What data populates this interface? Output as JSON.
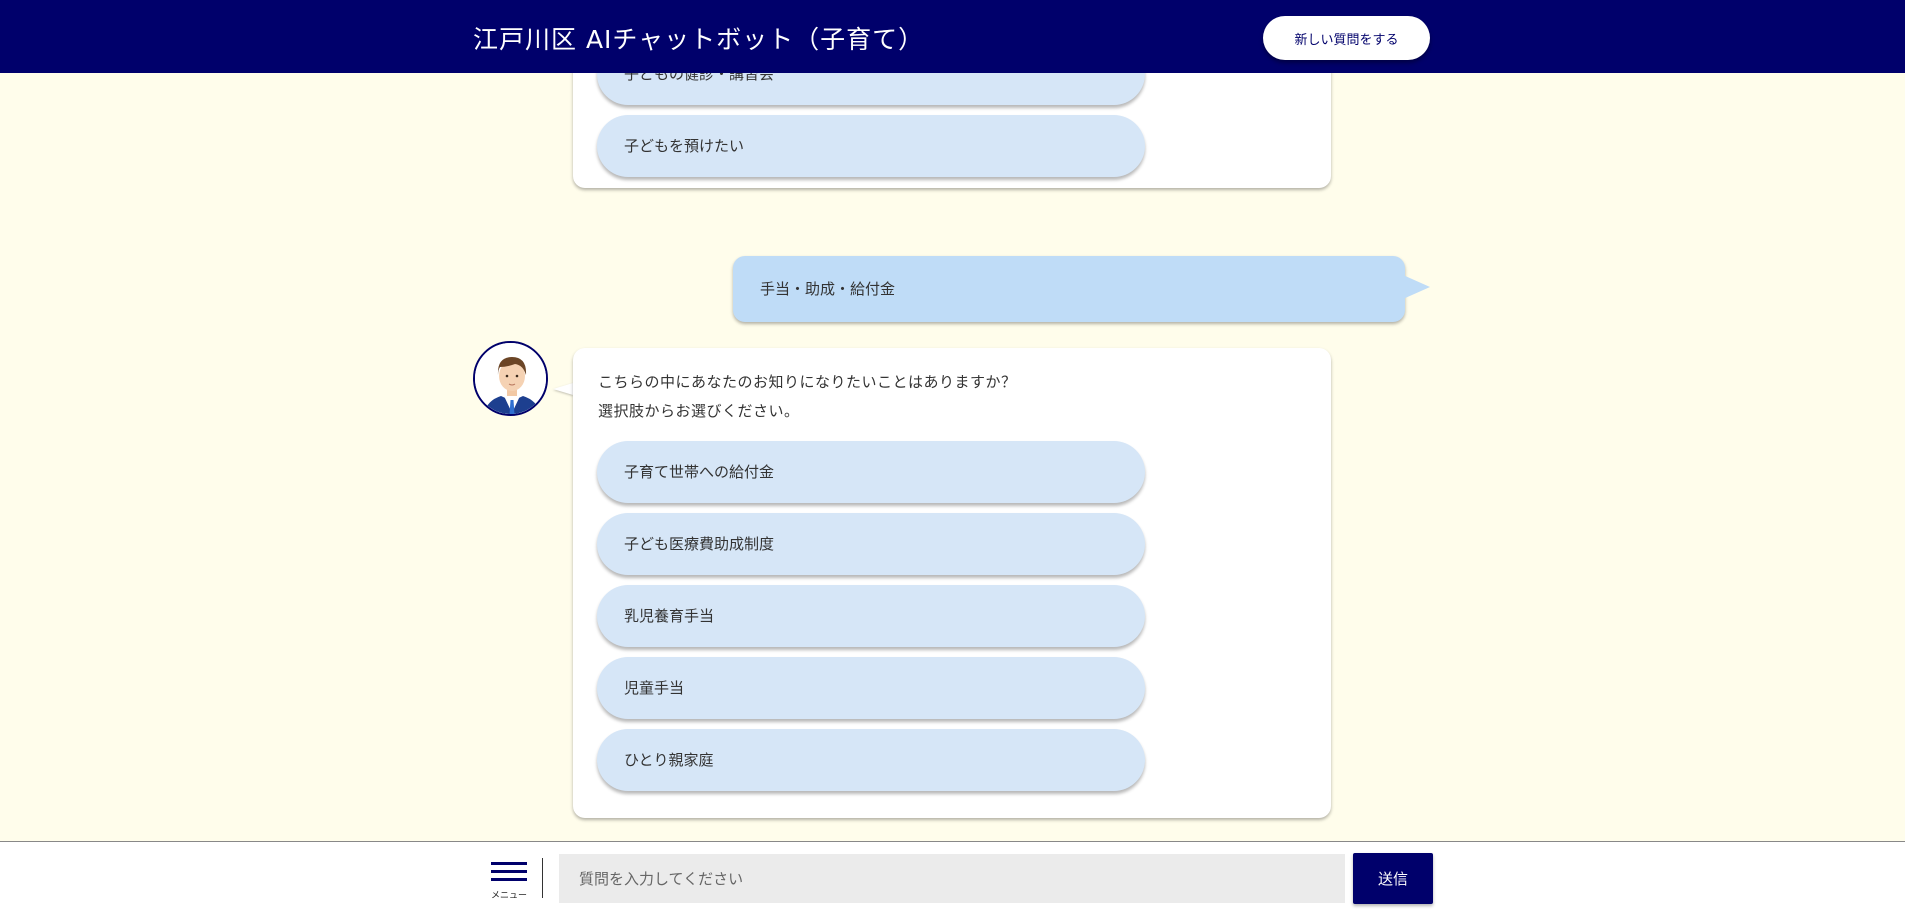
{
  "header": {
    "title": "江戸川区 AIチャットボット（子育て）",
    "new_question_label": "新しい質問をする"
  },
  "previous_bot_message": {
    "choices": [
      {
        "label": "子どもの健診・講習会"
      },
      {
        "label": "子どもを預けたい"
      }
    ]
  },
  "user_message": {
    "text": "手当・助成・給付金"
  },
  "bot_message": {
    "lines": [
      "こちらの中にあなたのお知りになりたいことはありますか？",
      "選択肢からお選びください。"
    ],
    "choices": [
      {
        "label": "子育て世帯への給付金"
      },
      {
        "label": "子ども医療費助成制度"
      },
      {
        "label": "乳児養育手当"
      },
      {
        "label": "児童手当"
      },
      {
        "label": "ひとり親家庭"
      }
    ]
  },
  "footer": {
    "menu_label": "メニュー",
    "input_placeholder": "質問を入力してください",
    "input_value": "",
    "send_label": "送信"
  },
  "colors": {
    "brand_navy": "#00006b",
    "background": "#fffdeb",
    "choice_bg": "#d6e6f7",
    "user_bubble_bg": "#bfdcf7"
  },
  "icons": {
    "menu": "hamburger-menu-icon",
    "avatar": "operator-avatar-icon"
  }
}
